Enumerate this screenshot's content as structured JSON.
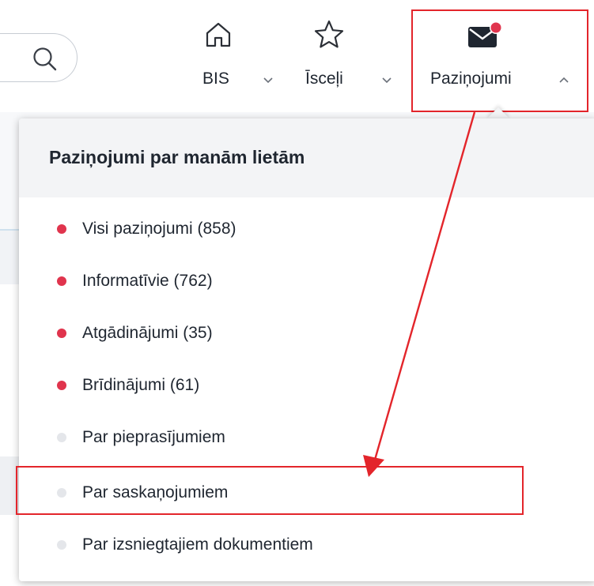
{
  "header": {
    "nav": [
      {
        "label": "BIS",
        "icon": "home-icon"
      },
      {
        "label": "Īsceļi",
        "icon": "star-icon"
      },
      {
        "label": "Paziņojumi",
        "icon": "mail-icon",
        "has_badge": true
      }
    ]
  },
  "dropdown": {
    "title": "Paziņojumi par manām lietām",
    "items": [
      {
        "label": "Visi paziņojumi (858)",
        "status": "active"
      },
      {
        "label": "Informatīvie (762)",
        "status": "active"
      },
      {
        "label": "Atgādinājumi (35)",
        "status": "active"
      },
      {
        "label": "Brīdinājumi (61)",
        "status": "active"
      },
      {
        "label": "Par pieprasījumiem",
        "status": "muted"
      },
      {
        "label": "Par saskaņojumiem",
        "status": "muted"
      },
      {
        "label": "Par izsniegtajiem dokumentiem",
        "status": "muted"
      }
    ]
  },
  "colors": {
    "accent_dot": "#e0344d",
    "annotation_red": "#e3252b",
    "muted_dot": "#e4e6ea"
  }
}
